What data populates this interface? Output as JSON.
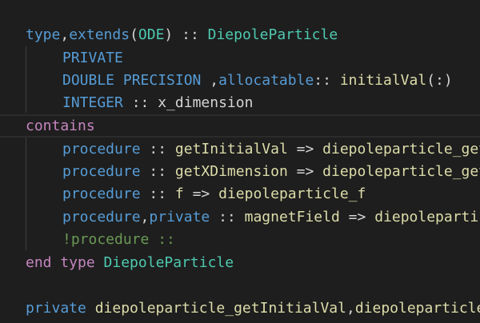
{
  "editor": {
    "colors": {
      "background": "#1e1e1e",
      "keyword": "#569cd6",
      "control_keyword": "#c586c0",
      "type": "#4ec9b0",
      "function": "#dcdcaa",
      "identifier": "#9cdcfe",
      "plain": "#d4d4d4",
      "comment": "#6a9955"
    },
    "lines": [
      {
        "tokens": [
          "type",
          ",",
          "extends",
          "(",
          "ODE",
          ")",
          " :: ",
          "DiepoleParticle"
        ]
      },
      {
        "tokens": [
          "PRIVATE"
        ]
      },
      {
        "tokens": [
          "DOUBLE PRECISION",
          " ,",
          "allocatable",
          ":: ",
          "initialVal",
          "(:)"
        ]
      },
      {
        "tokens": [
          "INTEGER",
          " :: ",
          "x_dimension"
        ]
      },
      {
        "tokens": [
          "contains"
        ]
      },
      {
        "tokens": [
          "procedure",
          " :: ",
          "getInitialVal",
          " => ",
          "diepoleparticle_getInitialVal"
        ]
      },
      {
        "tokens": [
          "procedure",
          " :: ",
          "getXDimension",
          " => ",
          "diepoleparticle_getXDimension"
        ]
      },
      {
        "tokens": [
          "procedure",
          " :: ",
          "f",
          " => ",
          "diepoleparticle_f"
        ]
      },
      {
        "tokens": [
          "procedure",
          ",",
          "private",
          " :: ",
          "magnetField",
          " => ",
          "diepoleparticle_magnetField"
        ]
      },
      {
        "tokens": [
          "!procedure ::"
        ]
      },
      {
        "tokens": [
          "end type",
          " ",
          "DiepoleParticle"
        ]
      },
      {
        "tokens": []
      },
      {
        "tokens": [
          "private",
          " ",
          "diepoleparticle_getInitialVal",
          ",",
          "diepoleparticle_getXDimension"
        ]
      }
    ]
  }
}
